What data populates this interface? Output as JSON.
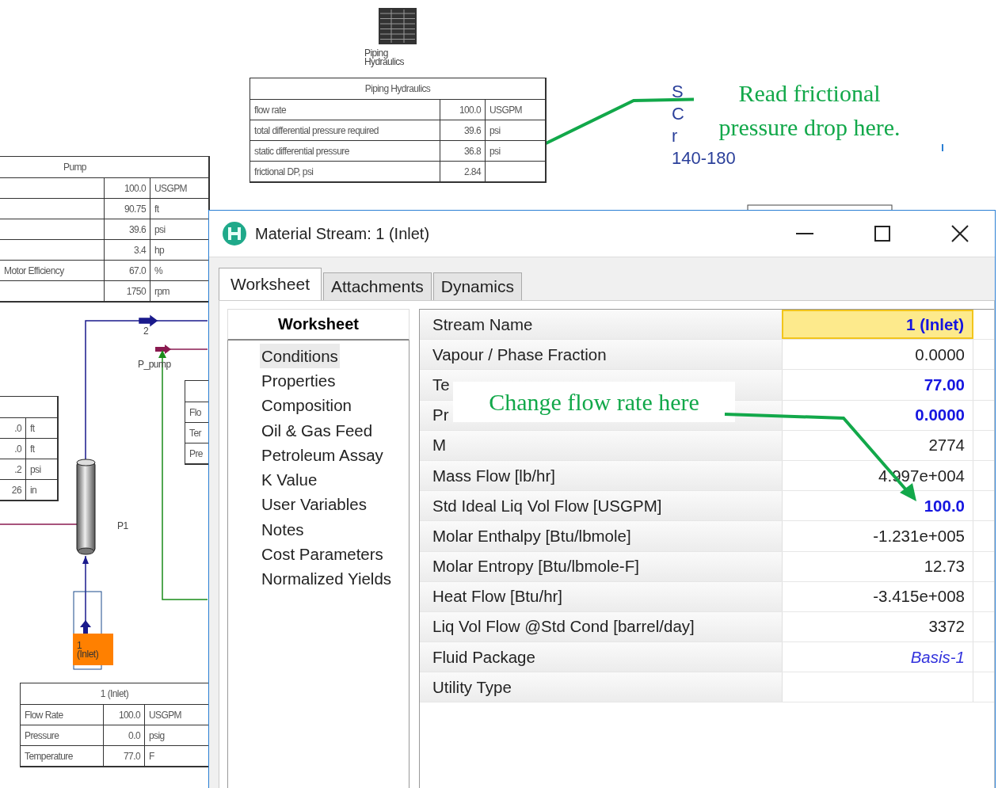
{
  "flowsheet": {
    "piping_icon_label": "Piping Hydraulics",
    "piping_table": {
      "title": "Piping Hydraulics",
      "rows": [
        {
          "name": "flow rate",
          "value": "100.0",
          "unit": "USGPM"
        },
        {
          "name": "total differential pressure required",
          "value": "39.6",
          "unit": "psi"
        },
        {
          "name": "static differential pressure",
          "value": "36.8",
          "unit": "psi"
        },
        {
          "name": "frictional DP, psi",
          "value": "2.84"
        }
      ]
    },
    "pump_table": {
      "title": "Pump",
      "rows": [
        {
          "value": "100.0",
          "unit": "USGPM"
        },
        {
          "value": "90.75",
          "unit": "ft"
        },
        {
          "value": "39.6",
          "unit": "psi"
        },
        {
          "value": "3.4",
          "unit": "hp"
        },
        {
          "name": "Motor Efficiency",
          "value": "67.0",
          "unit": "%"
        },
        {
          "value": "1750",
          "unit": "rpm"
        }
      ]
    },
    "left_table": {
      "rows": [
        {
          "value": ".0",
          "unit": "ft"
        },
        {
          "value": ".0",
          "unit": "ft"
        },
        {
          "value": ".2",
          "unit": "psi"
        },
        {
          "value": "26",
          "unit": "in"
        }
      ]
    },
    "right_table": {
      "rows": [
        {
          "name": "Flo"
        },
        {
          "name": "Ter"
        },
        {
          "name": "Pre"
        }
      ]
    },
    "inlet_table": {
      "title": "1 (Inlet)",
      "rows": [
        {
          "name": "Flow Rate",
          "value": "100.0",
          "unit": "USGPM"
        },
        {
          "name": "Pressure",
          "value": "0.0",
          "unit": "psig"
        },
        {
          "name": "Temperature",
          "value": "77.0",
          "unit": "F"
        }
      ]
    },
    "stream_label": "2",
    "energy_label": "P_pump",
    "pipe_label": "P1",
    "feed_label": "1 (Inlet)",
    "side_text": [
      "S",
      "C",
      "r",
      "140-180"
    ]
  },
  "annotations": [
    {
      "text": "Read frictional pressure drop here."
    },
    {
      "text": "Change flow rate here"
    }
  ],
  "dialog": {
    "title": "Material Stream: 1 (Inlet)",
    "tabs": [
      {
        "label": "Worksheet",
        "selected": true
      },
      {
        "label": "Attachments",
        "selected": false
      },
      {
        "label": "Dynamics",
        "selected": false
      }
    ],
    "nav_header": "Worksheet",
    "nav_items": [
      {
        "label": "Conditions",
        "selected": true
      },
      {
        "label": "Properties",
        "selected": false
      },
      {
        "label": "Composition",
        "selected": false
      },
      {
        "label": "Oil & Gas Feed",
        "selected": false
      },
      {
        "label": "Petroleum Assay",
        "selected": false
      },
      {
        "label": "K Value",
        "selected": false
      },
      {
        "label": "User Variables",
        "selected": false
      },
      {
        "label": "Notes",
        "selected": false
      },
      {
        "label": "Cost Parameters",
        "selected": false
      },
      {
        "label": "Normalized Yields",
        "selected": false
      }
    ],
    "rows": [
      {
        "label": "Stream Name",
        "value": "1 (Inlet)",
        "kind": "name"
      },
      {
        "label": "Vapour / Phase Fraction",
        "value": "0.0000",
        "kind": "calc"
      },
      {
        "label": "Te",
        "value": "77.00",
        "kind": "spec"
      },
      {
        "label": "Pr",
        "value": "0.0000",
        "kind": "spec"
      },
      {
        "label": "M",
        "value": "2774",
        "kind": "calc"
      },
      {
        "label": "Mass Flow [lb/hr]",
        "value": "4.997e+004",
        "kind": "calc"
      },
      {
        "label": "Std Ideal Liq Vol Flow [USGPM]",
        "value": "100.0",
        "kind": "spec"
      },
      {
        "label": "Molar Enthalpy [Btu/lbmole]",
        "value": "-1.231e+005",
        "kind": "calc"
      },
      {
        "label": "Molar Entropy [Btu/lbmole-F]",
        "value": "12.73",
        "kind": "calc"
      },
      {
        "label": "Heat Flow [Btu/hr]",
        "value": "-3.415e+008",
        "kind": "calc"
      },
      {
        "label": "Liq Vol Flow @Std Cond [barrel/day]",
        "value": "3372",
        "kind": "calc"
      },
      {
        "label": "Fluid Package",
        "value": "Basis-1",
        "kind": "link"
      },
      {
        "label": "Utility Type",
        "kind": "calc"
      }
    ]
  }
}
